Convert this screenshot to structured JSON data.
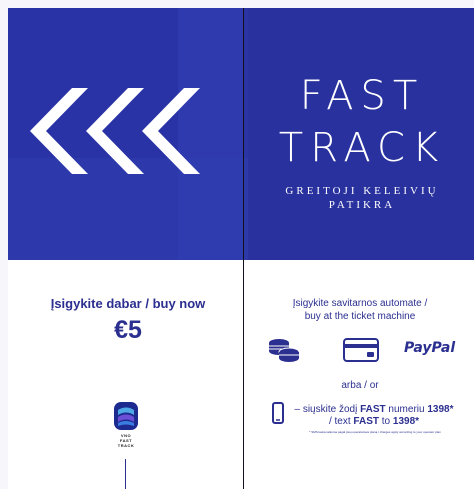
{
  "banner": {
    "title_line1": "FAST",
    "title_line2": "TRACK",
    "subtitle_line1": "GREITOJI KELEIVIŲ",
    "subtitle_line2": "PATIKRA"
  },
  "left_panel": {
    "buy_label": "Įsigykite dabar / buy now",
    "price": "€5",
    "app_name_line1": "VNO",
    "app_name_line2": "FAST",
    "app_name_line3": "TRACK"
  },
  "right_panel": {
    "machine_line1": "Įsigykite savitarnos automate /",
    "machine_line2": "buy at the ticket machine",
    "payment_icons": [
      "coins-icon",
      "card-icon"
    ],
    "paypal": "PayPal",
    "or_label": "arba / or",
    "sms_line1_prefix": "– siųskite žodį ",
    "sms_keyword": "FAST",
    "sms_line1_mid": " numeriu ",
    "sms_number": "1398*",
    "sms_line2_prefix": "/ text ",
    "sms_line2_mid": " to ",
    "fine_print": "* SMS kaina taikoma pagal jūsų operatoriaus planą / charges apply according to your operator plan"
  },
  "colors": {
    "brand_blue": "#2a33a6",
    "text_blue": "#2b2f8f",
    "white": "#ffffff"
  }
}
